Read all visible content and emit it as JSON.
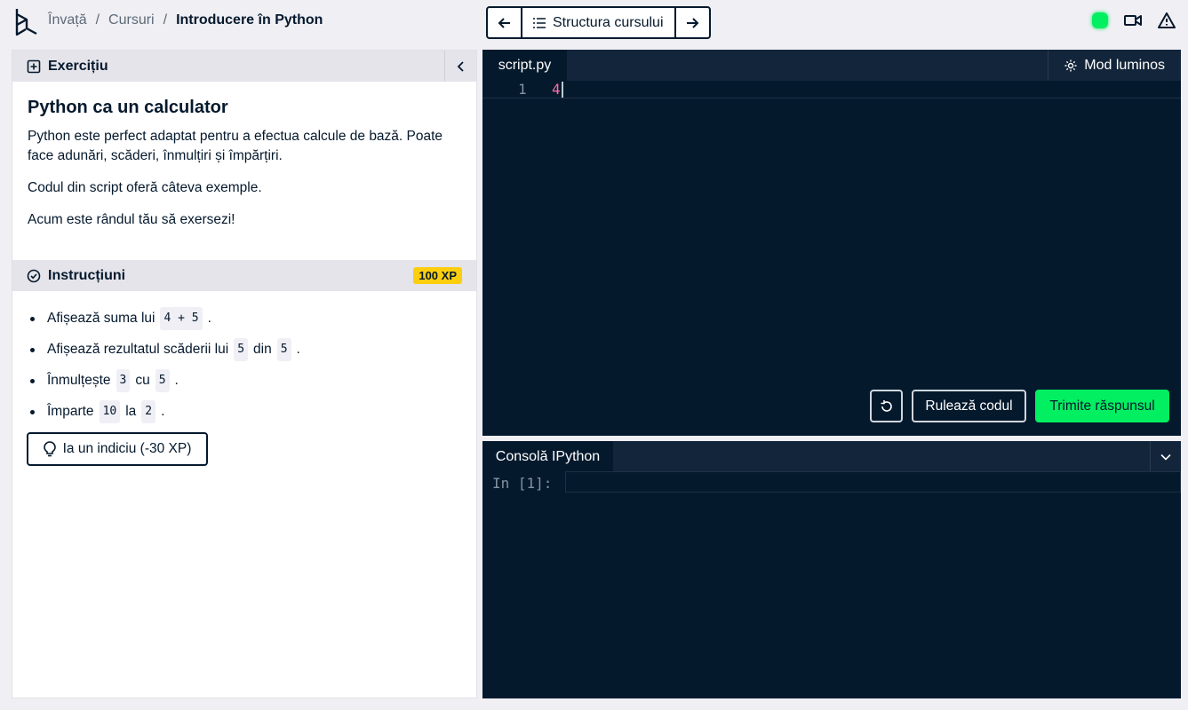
{
  "header": {
    "breadcrumb": [
      "Învață",
      "Cursuri",
      "Introducere în Python"
    ],
    "nav": {
      "back_icon": "arrow-left-icon",
      "outline_label": "Structura cursului",
      "forward_icon": "arrow-right-icon"
    }
  },
  "exercise": {
    "section_label": "Exercițiu",
    "title": "Python ca un calculator",
    "paragraphs": [
      "Python este perfect adaptat pentru a efectua calcule de bază. Poate face adunări, scăderi, înmulțiri și împărțiri.",
      "Codul din script oferă câteva exemple.",
      "Acum este rândul tău să exersezi!"
    ]
  },
  "instructions": {
    "section_label": "Instrucțiuni",
    "xp": "100 XP",
    "items": [
      {
        "before": "Afișează suma lui",
        "code1": "4 + 5",
        "mid": "",
        "code2": "",
        "after": "."
      },
      {
        "before": "Afișează rezultatul scăderii lui",
        "code1": "5",
        "mid": "din",
        "code2": "5",
        "after": "."
      },
      {
        "before": "Înmulțește",
        "code1": "3",
        "mid": "cu",
        "code2": "5",
        "after": "."
      },
      {
        "before": "Împarte",
        "code1": "10",
        "mid": "la",
        "code2": "2",
        "after": "."
      }
    ],
    "hint_label": "Ia un indiciu (-30 XP)"
  },
  "editor": {
    "tab": "script.py",
    "mode_label": "Mod luminos",
    "lines": [
      {
        "number": "1",
        "text": "4"
      }
    ],
    "run_label": "Rulează codul",
    "submit_label": "Trimite răspunsul"
  },
  "console": {
    "tab": "Consolă IPython",
    "prompt": "In [1]:"
  },
  "colors": {
    "accent_green": "#03ef62",
    "navy": "#05192d",
    "xp_yellow": "#fcce0d",
    "code_pink": "#ff6ea9"
  }
}
